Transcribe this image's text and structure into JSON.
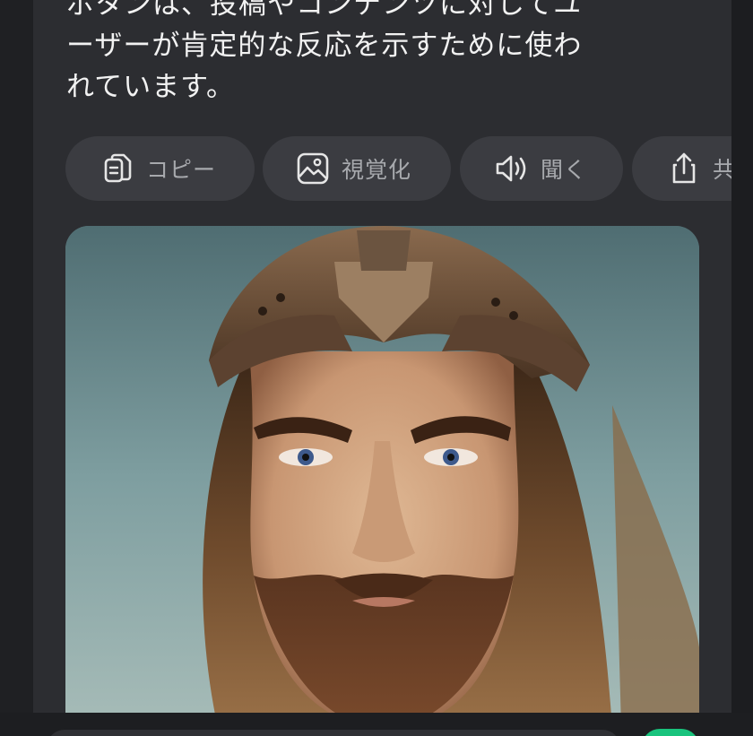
{
  "message": {
    "text": "ボタンは、投稿やコンテンツに対してユ\nーザーが肯定的な反応を示すために使わ\nれています。"
  },
  "actions": {
    "copy_label": "コピー",
    "copy_icon": "copy-icon",
    "visualize_label": "視覚化",
    "visualize_icon": "image-icon",
    "listen_label": "聞く",
    "listen_icon": "speaker-icon",
    "share_label": "共有",
    "share_icon": "share-icon"
  },
  "colors": {
    "background": "#1f2023",
    "panel": "#2c2d31",
    "chip": "#3b3c41",
    "chip_text": "#a7a9ad",
    "message_text": "#f2f2f2",
    "send_accent": "#19c37d"
  }
}
